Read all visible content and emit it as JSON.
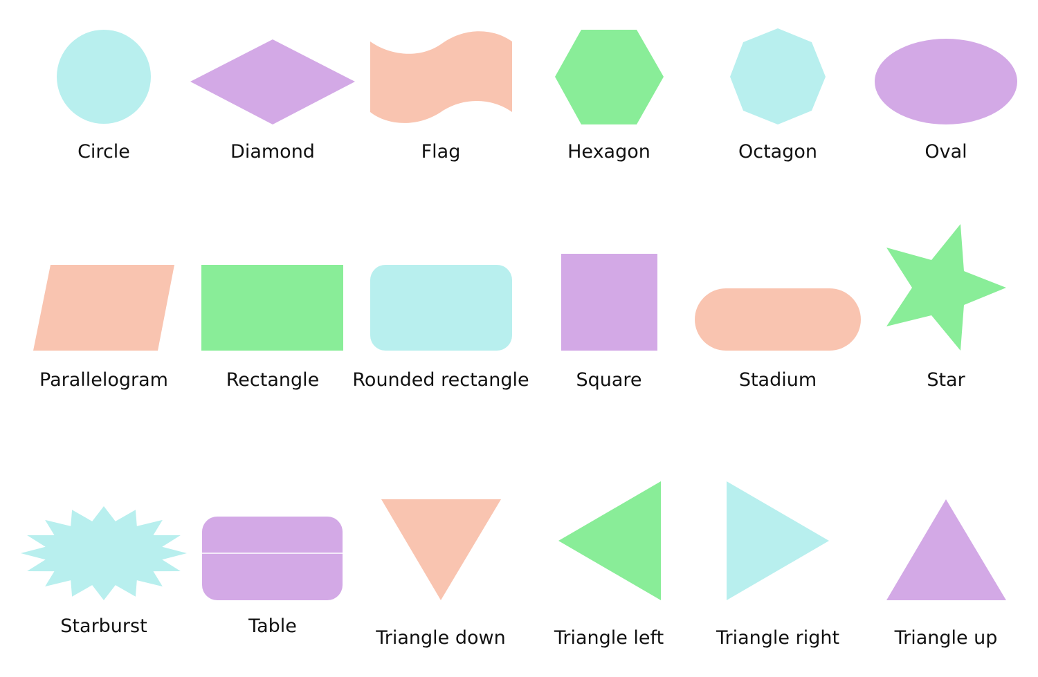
{
  "colors": {
    "cyan": "#b8efee",
    "purple": "#d3a9e6",
    "peach": "#f9c4b0",
    "green": "#89ed98"
  },
  "shapes": [
    {
      "label": "Circle",
      "color": "cyan"
    },
    {
      "label": "Diamond",
      "color": "purple"
    },
    {
      "label": "Flag",
      "color": "peach"
    },
    {
      "label": "Hexagon",
      "color": "green"
    },
    {
      "label": "Octagon",
      "color": "cyan"
    },
    {
      "label": "Oval",
      "color": "purple"
    },
    {
      "label": "Parallelogram",
      "color": "peach"
    },
    {
      "label": "Rectangle",
      "color": "green"
    },
    {
      "label": "Rounded rectangle",
      "color": "cyan"
    },
    {
      "label": "Square",
      "color": "purple"
    },
    {
      "label": "Stadium",
      "color": "peach"
    },
    {
      "label": "Star",
      "color": "green"
    },
    {
      "label": "Starburst",
      "color": "cyan"
    },
    {
      "label": "Table",
      "color": "purple"
    },
    {
      "label": "Triangle down",
      "color": "peach"
    },
    {
      "label": "Triangle left",
      "color": "green"
    },
    {
      "label": "Triangle right",
      "color": "cyan"
    },
    {
      "label": "Triangle up",
      "color": "purple"
    }
  ]
}
